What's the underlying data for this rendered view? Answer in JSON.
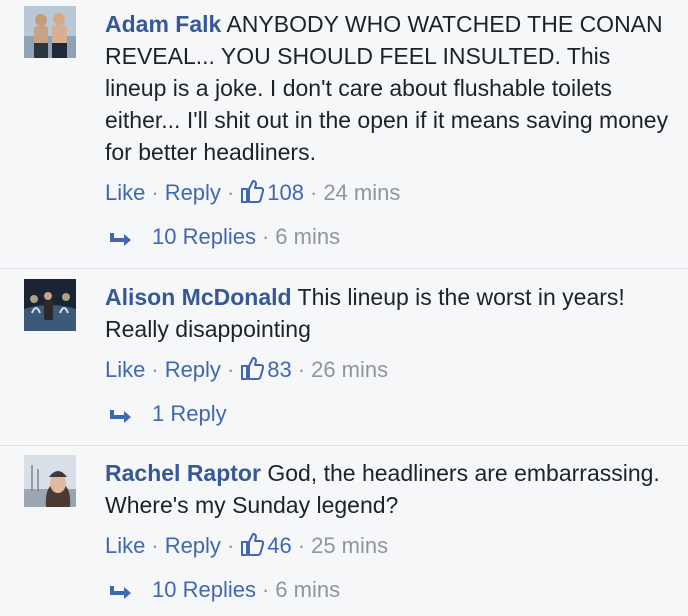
{
  "comments": [
    {
      "author": "Adam Falk",
      "text": "ANYBODY WHO WATCHED THE CONAN REVEAL... YOU SHOULD FEEL INSULTED. This lineup is a joke. I don't care about flushable toilets either... I'll shit out in the open if it means saving money for better headliners.",
      "like_label": "Like",
      "reply_label": "Reply",
      "like_count": "108",
      "time": "24 mins",
      "replies_label": "10 Replies",
      "replies_time": "6 mins",
      "avatar_icon": "avatar-photo-two-men"
    },
    {
      "author": "Alison McDonald",
      "text": "This lineup is the worst in years! Really disappointing",
      "like_label": "Like",
      "reply_label": "Reply",
      "like_count": "83",
      "time": "26 mins",
      "replies_label": "1 Reply",
      "avatar_icon": "avatar-photo-night-fountain"
    },
    {
      "author": "Rachel Raptor",
      "text": "God, the headliners are embarrassing. Where's my Sunday legend?",
      "like_label": "Like",
      "reply_label": "Reply",
      "like_count": "46",
      "time": "25 mins",
      "replies_label": "10 Replies",
      "replies_time": "6 mins",
      "avatar_icon": "avatar-photo-woman-beanie"
    }
  ],
  "colors": {
    "link": "#4267b2",
    "author": "#365899",
    "text": "#1d2129",
    "meta": "#90949c",
    "background": "#f6f7f9"
  }
}
